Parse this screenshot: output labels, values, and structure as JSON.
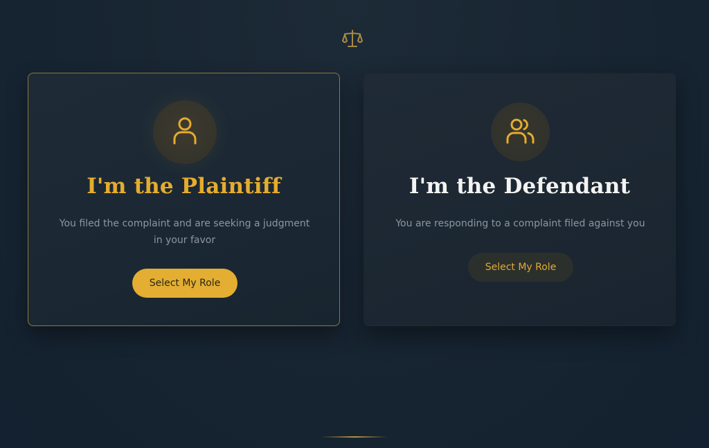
{
  "header": {
    "icon": "scales-icon"
  },
  "roles": [
    {
      "icon": "user-icon",
      "title": "I'm the Plaintiff",
      "description": "You filed the complaint and are seeking a judgment in your favor",
      "button_label": "Select My Role",
      "selected": true
    },
    {
      "icon": "users-icon",
      "title": "I'm the Defendant",
      "description": "You are responding to a complaint filed against you",
      "button_label": "Select My Role",
      "selected": false
    }
  ],
  "colors": {
    "accent": "#e3ae31",
    "background": "#172431",
    "card": "#1c2833",
    "muted_text": "#8d96a0"
  }
}
